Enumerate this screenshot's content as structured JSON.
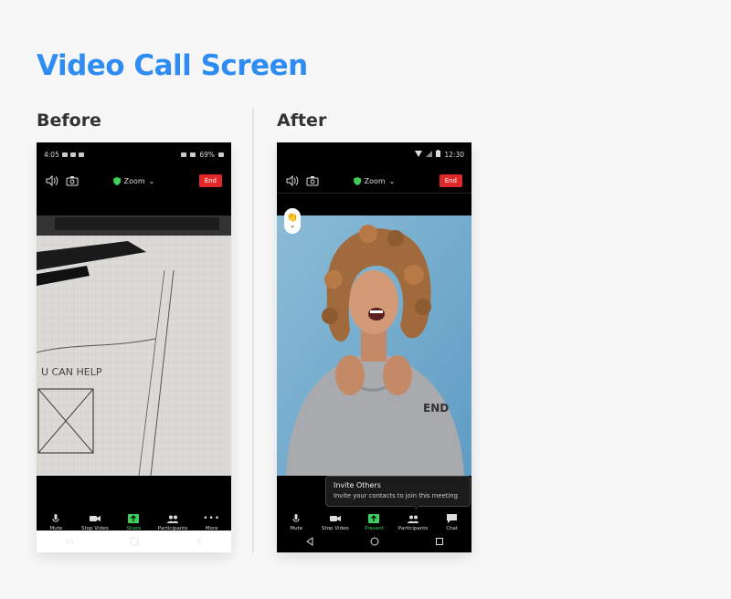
{
  "page": {
    "title": "Video Call Screen"
  },
  "columns": {
    "before_label": "Before",
    "after_label": "After"
  },
  "before": {
    "status": {
      "time": "4:05",
      "battery": "69%"
    },
    "toolbar": {
      "meeting_name": "Zoom",
      "end_label": "End"
    },
    "controls": [
      {
        "label": "Mute",
        "icon": "mic-icon"
      },
      {
        "label": "Stop Video",
        "icon": "camera-icon"
      },
      {
        "label": "Share",
        "icon": "share-icon",
        "active": true
      },
      {
        "label": "Participants",
        "icon": "people-icon"
      },
      {
        "label": "More",
        "icon": "more-icon"
      }
    ]
  },
  "after": {
    "status": {
      "time": "12:30"
    },
    "toolbar": {
      "meeting_name": "Zoom",
      "end_label": "End"
    },
    "tooltip": {
      "title": "Invite Others",
      "body": "Invite your contacts to join this meeting"
    },
    "controls": [
      {
        "label": "Mute",
        "icon": "mic-icon"
      },
      {
        "label": "Stop Video",
        "icon": "camera-icon"
      },
      {
        "label": "Present",
        "icon": "share-icon",
        "active": true
      },
      {
        "label": "Participants",
        "icon": "people-icon"
      },
      {
        "label": "Chat",
        "icon": "chat-icon"
      }
    ]
  },
  "colors": {
    "accent": "#2f8cf2",
    "end_red": "#e02828",
    "active_green": "#3dcf5a"
  }
}
